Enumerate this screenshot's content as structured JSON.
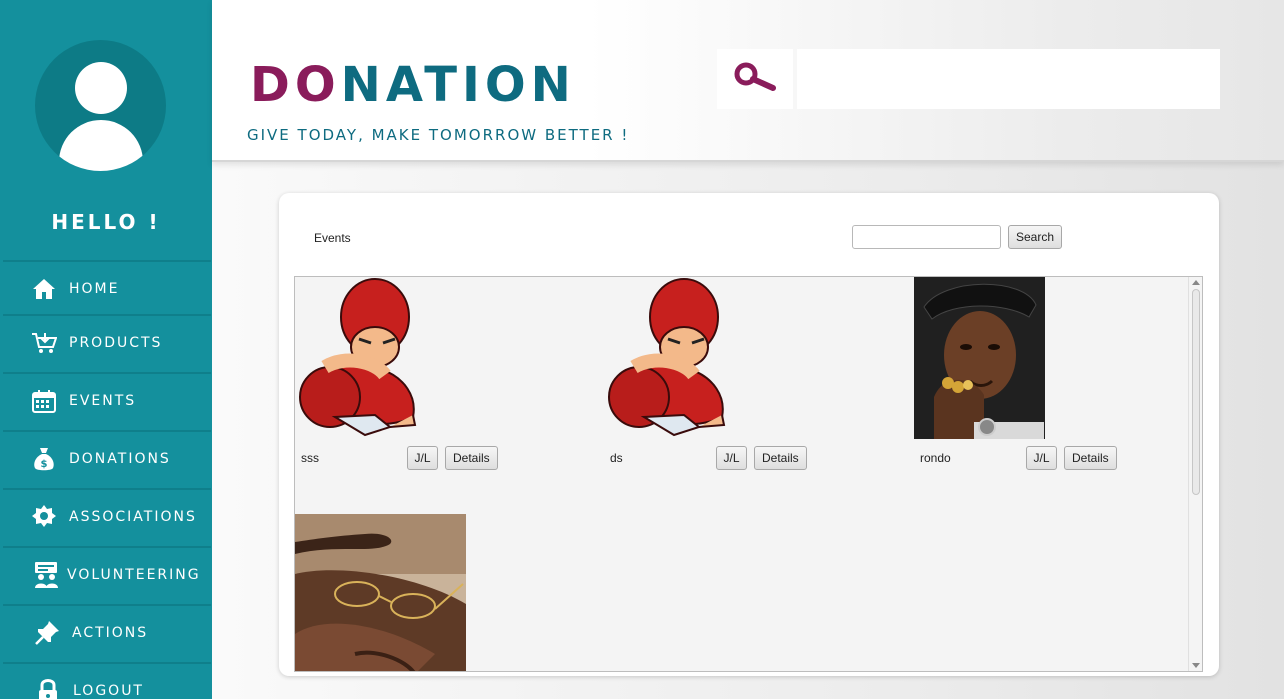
{
  "sidebar": {
    "greeting": "HELLO !",
    "items": [
      {
        "label": "HOME",
        "icon": "home-icon"
      },
      {
        "label": "PRODUCTS",
        "icon": "cart-icon"
      },
      {
        "label": "EVENTS",
        "icon": "calendar-icon"
      },
      {
        "label": "DONATIONS",
        "icon": "money-bag-icon"
      },
      {
        "label": "ASSOCIATIONS",
        "icon": "badge-icon"
      },
      {
        "label": "VOLUNTEERING",
        "icon": "volunteer-icon"
      },
      {
        "label": "ACTIONS",
        "icon": "pin-icon"
      },
      {
        "label": "LOGOUT",
        "icon": "lock-icon"
      }
    ]
  },
  "header": {
    "brand_accent": "DO",
    "brand_rest": "NATION",
    "tagline": "GIVE TODAY, MAKE TOMORROW BETTER !",
    "search_value": ""
  },
  "content": {
    "title": "Events",
    "search_value": "",
    "search_button": "Search",
    "events": [
      {
        "name": "sss",
        "jl_label": "J/L",
        "details_label": "Details",
        "image": "redhead-cartoon-player"
      },
      {
        "name": "ds",
        "jl_label": "J/L",
        "details_label": "Details",
        "image": "redhead-cartoon-player"
      },
      {
        "name": "rondo",
        "jl_label": "J/L",
        "details_label": "Details",
        "image": "portrait-photo"
      },
      {
        "name": "",
        "image": "glasses-photo"
      }
    ]
  },
  "colors": {
    "sidebar": "#14909d",
    "brand_accent": "#8a1c5b",
    "brand_primary": "#0e6b80"
  }
}
